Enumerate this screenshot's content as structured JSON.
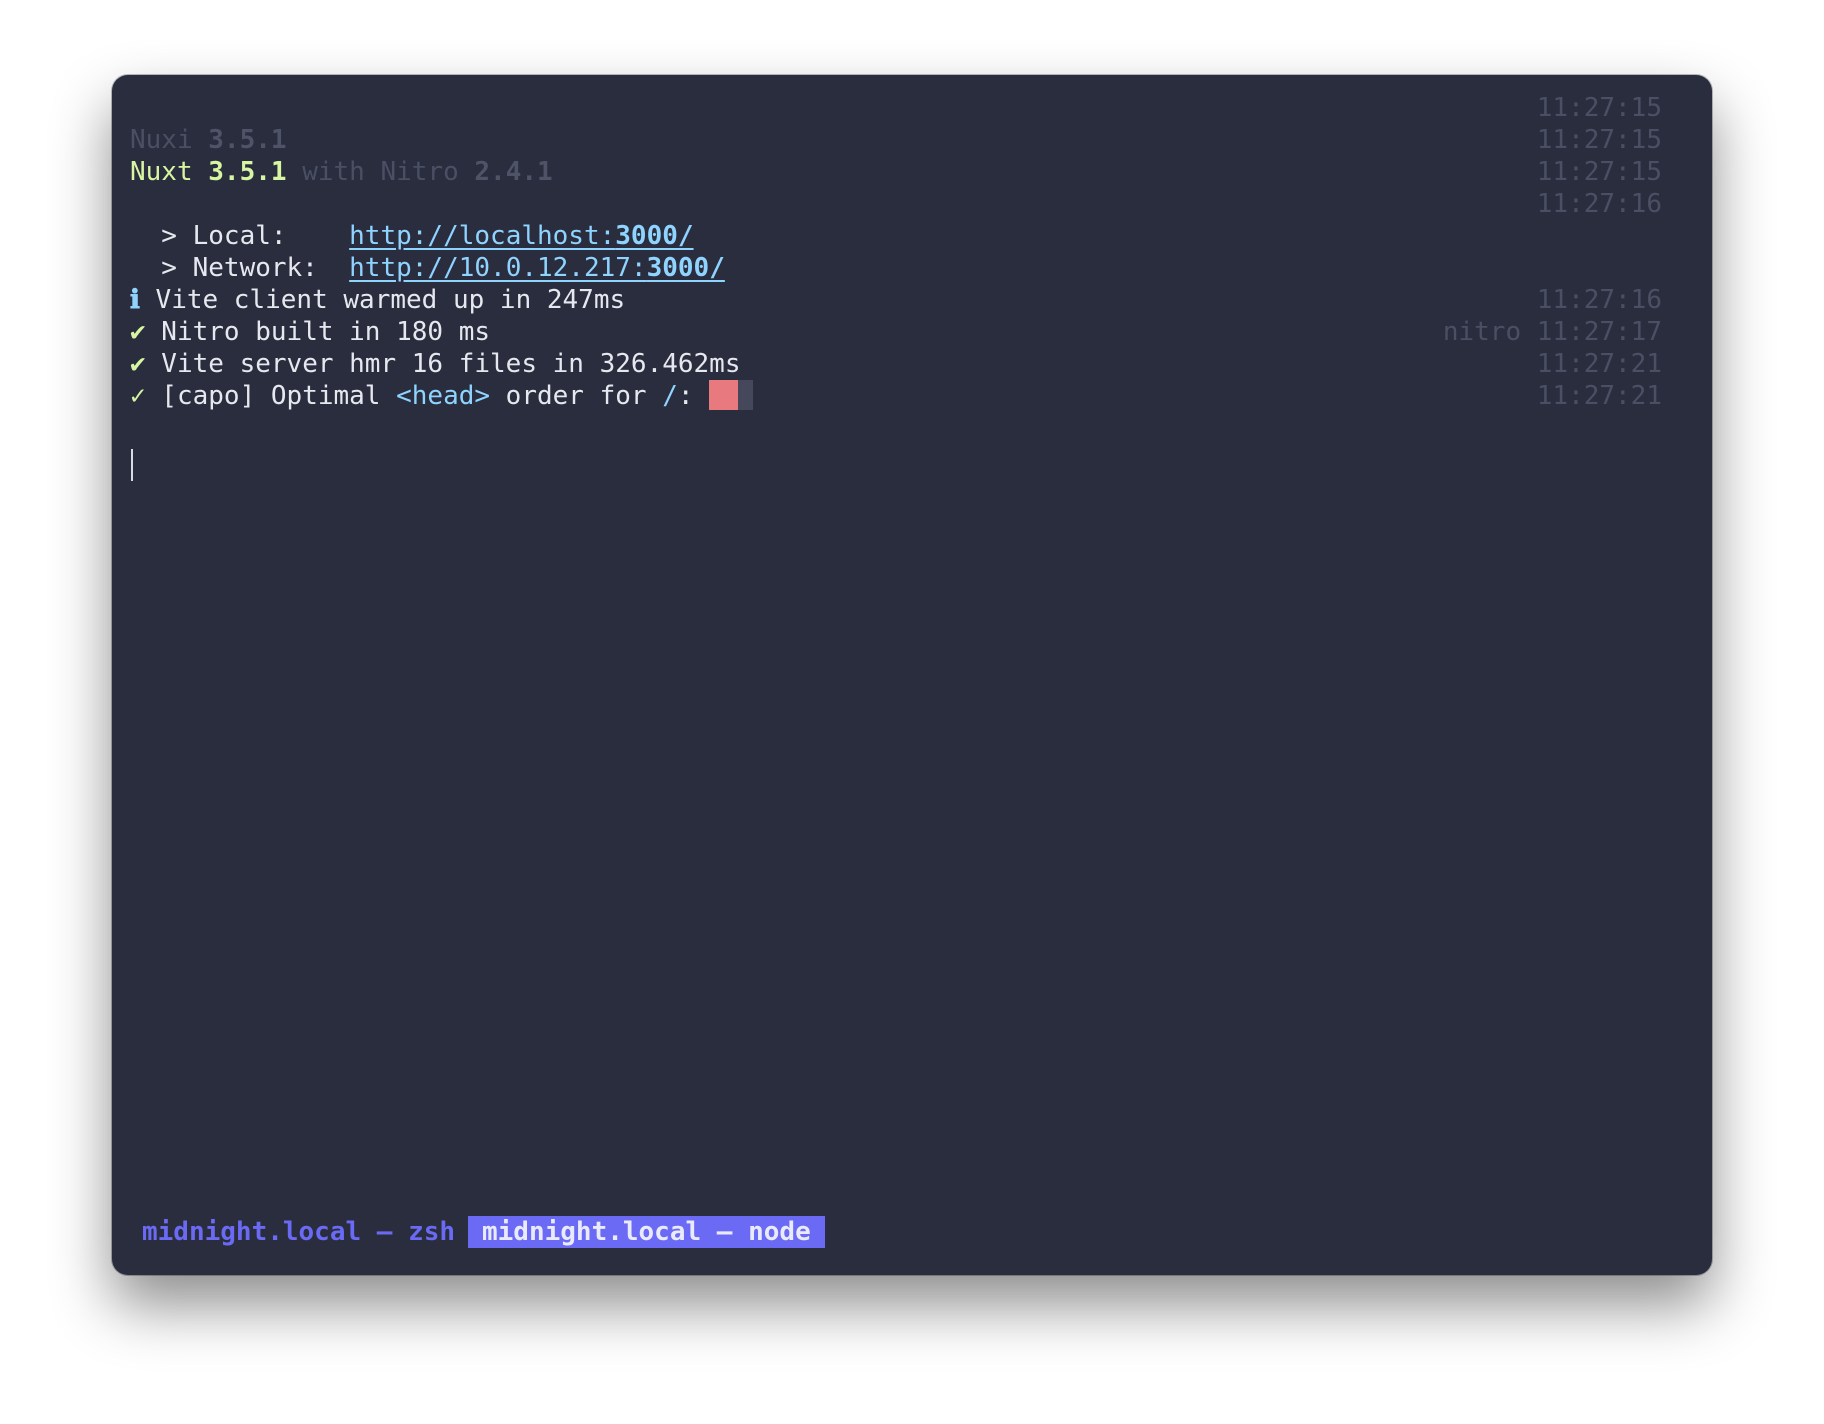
{
  "terminal": {
    "timestamps": {
      "t1": "11:27:15",
      "t2": "11:27:15",
      "t3": "11:27:15",
      "t4": "11:27:16",
      "t5": "11:27:16",
      "t6_tag": "nitro",
      "t6": "11:27:17",
      "t7": "11:27:21",
      "t8": "11:27:21"
    },
    "banner_dim": {
      "name": "Nuxi ",
      "version": "3.5.1"
    },
    "banner": {
      "name": "Nuxt ",
      "version": "3.5.1",
      "with": " with Nitro ",
      "nitro_version": "2.4.1"
    },
    "local": {
      "label": "  > Local:    ",
      "url_prefix": "http://localhost:",
      "url_port": "3000/"
    },
    "network": {
      "label": "  > Network:  ",
      "url_prefix": "http://10.0.12.217:",
      "url_port": "3000/"
    },
    "logs": [
      {
        "icon": "ℹ",
        "icon_name": "info-icon",
        "text": " Vite client warmed up in 247ms"
      },
      {
        "icon": "✔",
        "icon_name": "check-icon",
        "text": " Nitro built in 180 ms"
      },
      {
        "icon": "✔",
        "icon_name": "check-icon",
        "text": " Vite server hmr 16 files in 326.462ms"
      }
    ],
    "capo": {
      "icon": "✓",
      "prefix": " [capo] Optimal ",
      "tag": "<head>",
      "middle": " order for ",
      "path": "/",
      "suffix": ": ",
      "progress": 0.65
    }
  },
  "tabs": {
    "inactive": "midnight.local — zsh",
    "active": "midnight.local — node"
  },
  "colors": {
    "background": "#2a2d3e",
    "accent": "#6a6af4",
    "green": "#d8f5a2",
    "cyan": "#8fd3ff",
    "progress_fill": "#e87a7f"
  }
}
